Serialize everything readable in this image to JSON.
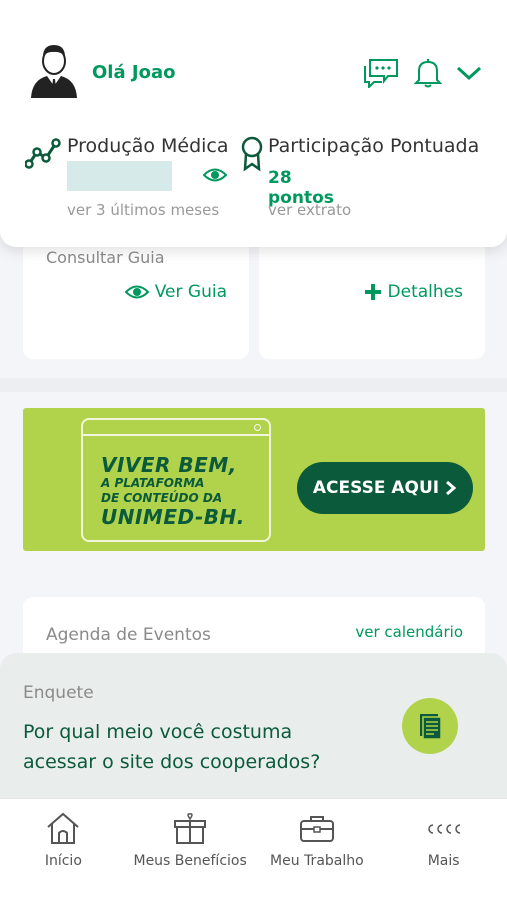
{
  "header": {
    "greeting": "Olá Joao",
    "icons": [
      "avatar-icon",
      "chat-icon",
      "bell-icon",
      "chevron-down-icon"
    ]
  },
  "stats": {
    "producao": {
      "title": "Produção Médica",
      "sub": "ver 3 últimos meses"
    },
    "participacao": {
      "title": "Participação Pontuada",
      "value": "28 pontos",
      "sub": "ver extrato"
    }
  },
  "cards": {
    "left": {
      "label": "Consultar Guia",
      "action": "Ver Guia"
    },
    "right": {
      "action": "Detalhes"
    }
  },
  "banner": {
    "line1": "VIVER BEM,",
    "line2": "A PLATAFORMA",
    "line3": "DE CONTEÚDO DA",
    "line4": "UNIMED-BH.",
    "cta": "ACESSE AQUI"
  },
  "agenda": {
    "title": "Agenda de Eventos",
    "link": "ver calendário"
  },
  "poll": {
    "label": "Enquete",
    "question": "Por qual meio você costuma acessar o site dos cooperados?"
  },
  "nav": [
    {
      "label": "Início",
      "icon": "home-icon"
    },
    {
      "label": "Meus Benefícios",
      "icon": "gift-icon"
    },
    {
      "label": "Meu Trabalho",
      "icon": "briefcase-icon"
    },
    {
      "label": "Mais",
      "icon": "more-icon"
    }
  ],
  "colors": {
    "primary": "#00995d",
    "dark": "#0a5a3b",
    "lime": "#b1d34b"
  }
}
